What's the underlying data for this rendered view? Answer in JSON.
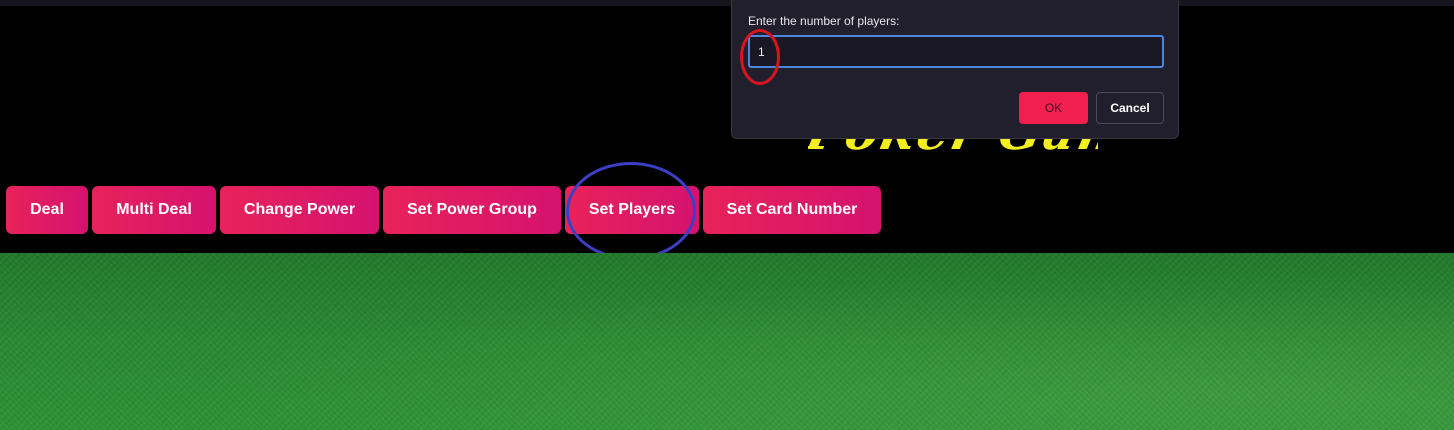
{
  "game_title": "Poker Game",
  "buttons": [
    {
      "label": "Deal"
    },
    {
      "label": "Multi Deal"
    },
    {
      "label": "Change Power"
    },
    {
      "label": "Set Power Group"
    },
    {
      "label": "Set Players"
    },
    {
      "label": "Set Card Number"
    }
  ],
  "dialog": {
    "message": "Enter the number of players:",
    "input_value": "1",
    "ok_label": "OK",
    "cancel_label": "Cancel"
  },
  "colors": {
    "button_gradient_start": "#e8225a",
    "button_gradient_end": "#d5126f",
    "title_yellow": "#f2ee1f",
    "felt_green": "#2a8a33",
    "dialog_bg": "#221f2d",
    "ok_button": "#f01f4f",
    "input_focus": "#4b86e0",
    "annotation_blue": "#3a3fc4",
    "annotation_red": "#d8141e"
  }
}
